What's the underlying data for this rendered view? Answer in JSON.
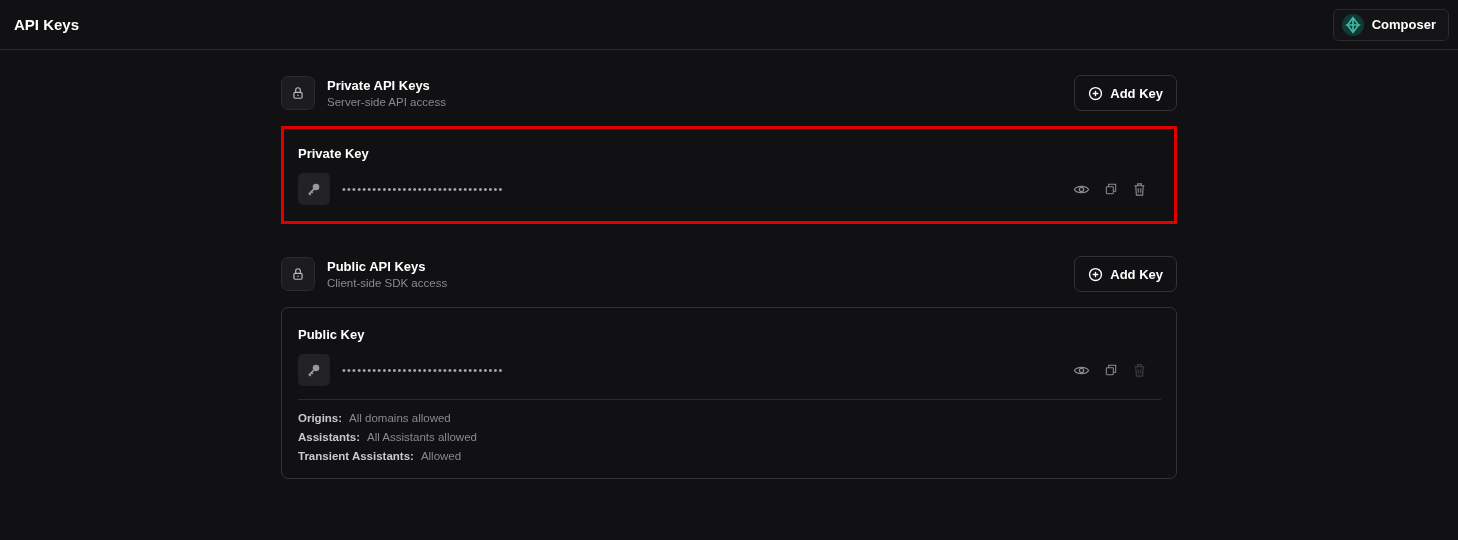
{
  "header": {
    "title": "API Keys",
    "workspace_button": "Composer"
  },
  "sections": [
    {
      "title": "Private API Keys",
      "subtitle": "Server-side API access",
      "add_button": "Add Key",
      "keys": [
        {
          "name": "Private Key",
          "masked_value": "••••••••••••••••••••••••••••••••",
          "highlighted": true,
          "delete_disabled": false
        }
      ]
    },
    {
      "title": "Public API Keys",
      "subtitle": "Client-side SDK access",
      "add_button": "Add Key",
      "keys": [
        {
          "name": "Public Key",
          "masked_value": "••••••••••••••••••••••••••••••••",
          "highlighted": false,
          "delete_disabled": true,
          "details": [
            {
              "label": "Origins:",
              "value": "All domains allowed"
            },
            {
              "label": "Assistants:",
              "value": "All Assistants allowed"
            },
            {
              "label": "Transient Assistants:",
              "value": "Allowed"
            }
          ]
        }
      ]
    }
  ]
}
